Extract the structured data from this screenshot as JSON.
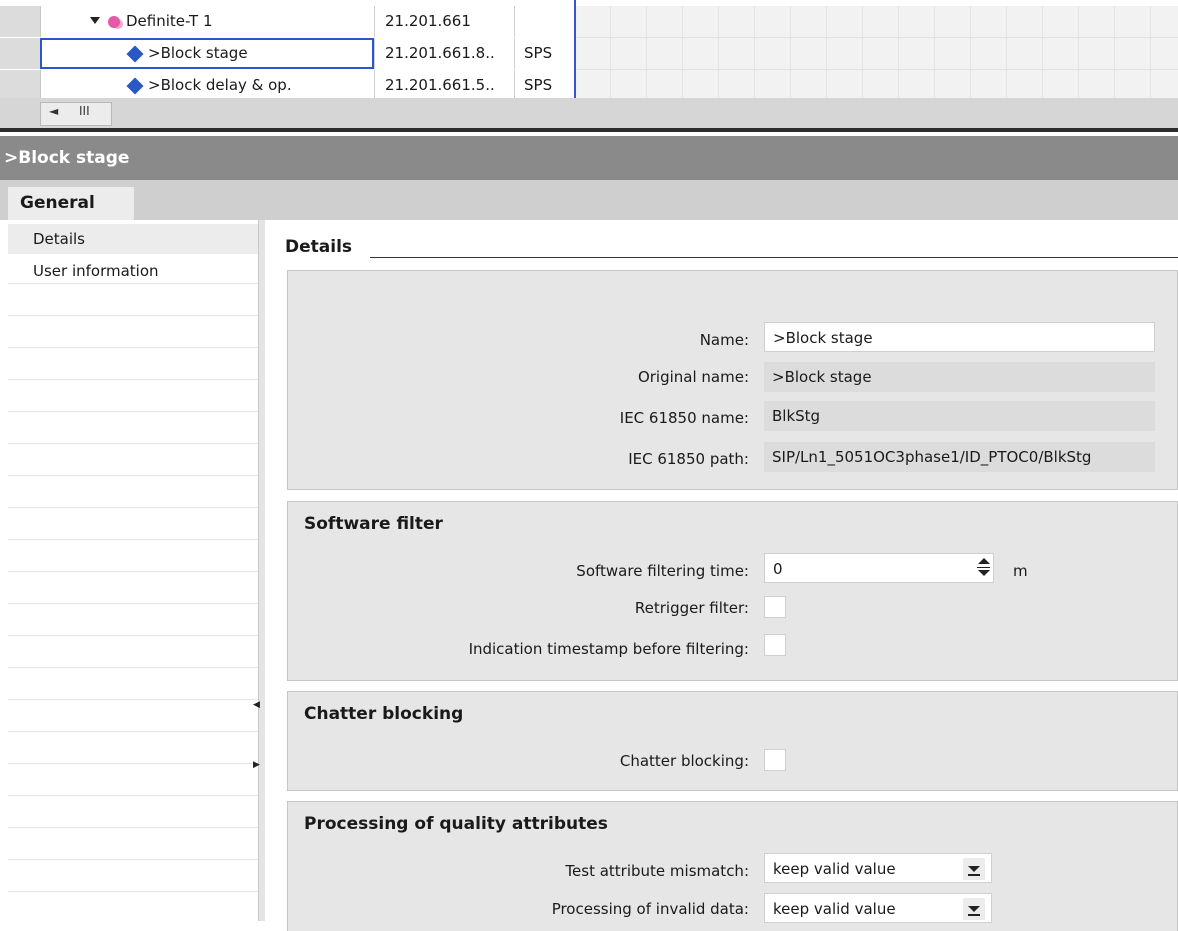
{
  "tree": {
    "rows": [
      {
        "name": "Definite-T 1",
        "value": "21.201.661",
        "type": ""
      },
      {
        "name": ">Block stage",
        "value": "21.201.661.8..",
        "type": "SPS"
      },
      {
        "name": ">Block delay & op.",
        "value": "21.201.661.5..",
        "type": "SPS"
      }
    ],
    "scroll_left": "◄",
    "scroll_thumb": "III"
  },
  "inspector": {
    "title": ">Block stage",
    "tab": "General"
  },
  "nav": {
    "items": [
      "Details",
      "User information"
    ]
  },
  "details": {
    "heading": "Details",
    "name_label": "Name:",
    "name_value": ">Block stage",
    "original_name_label": "Original name:",
    "original_name_value": ">Block stage",
    "iec_name_label": "IEC 61850 name:",
    "iec_name_value": "BlkStg",
    "iec_path_label": "IEC 61850 path:",
    "iec_path_value": "SIP/Ln1_5051OC3phase1/ID_PTOC0/BlkStg"
  },
  "software_filter": {
    "title": "Software filter",
    "time_label": "Software filtering time:",
    "time_value": "0",
    "time_unit": "m",
    "retrigger_label": "Retrigger filter:",
    "timestamp_label": "Indication timestamp before filtering:"
  },
  "chatter": {
    "title": "Chatter blocking",
    "label": "Chatter blocking:"
  },
  "quality": {
    "title": "Processing of quality attributes",
    "test_label": "Test attribute mismatch:",
    "test_value": "keep valid value",
    "invalid_label": "Processing of invalid data:",
    "invalid_value": "keep valid value"
  },
  "colors": {
    "header_bg": "#8a8a8a",
    "group_bg": "#e6e6e6",
    "selection_border": "#2a57c9"
  }
}
